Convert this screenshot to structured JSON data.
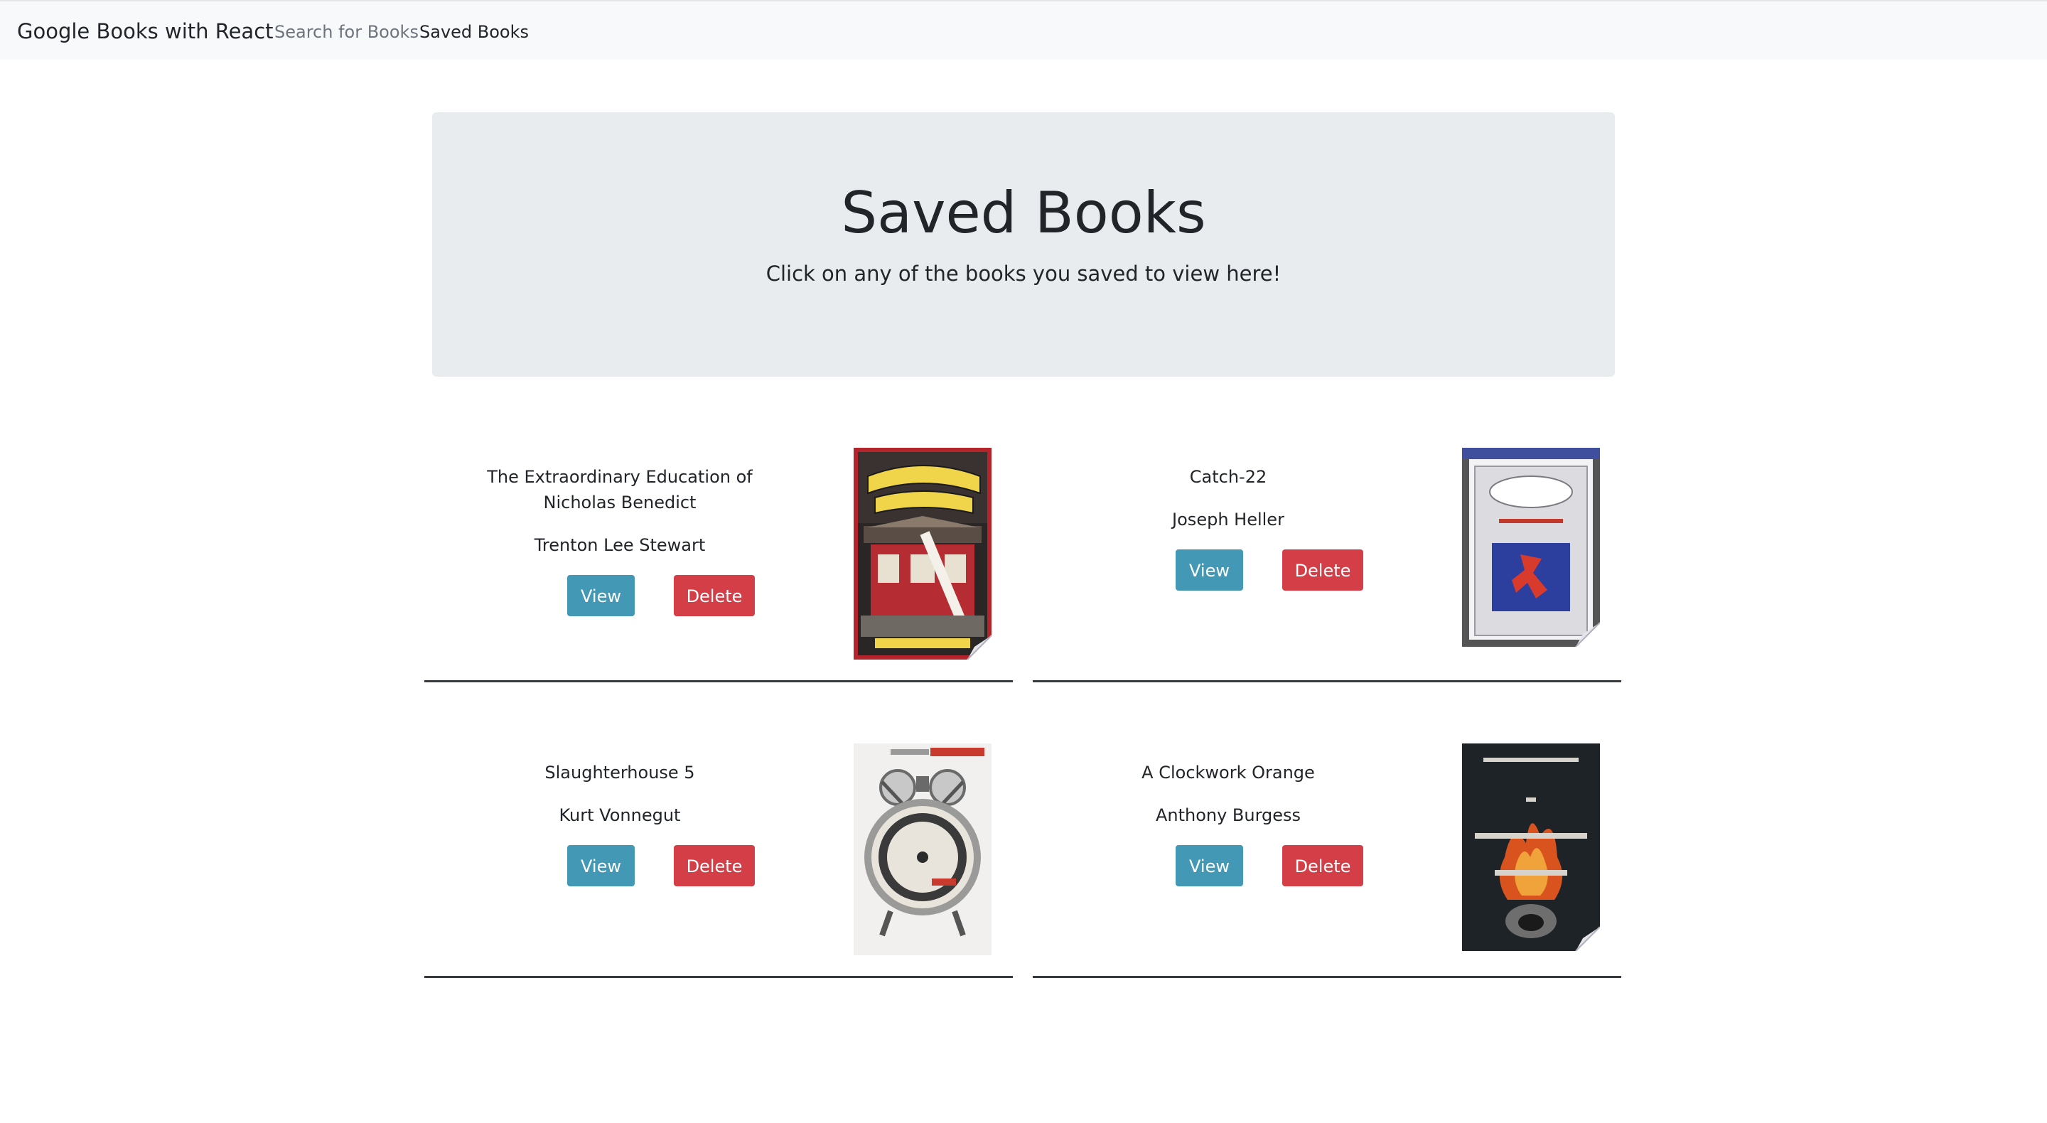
{
  "navbar": {
    "brand": "Google Books with React",
    "links": [
      "Search for Books",
      "Saved Books"
    ]
  },
  "jumbotron": {
    "title": "Saved Books",
    "subtitle": "Click on any of the books you saved to view here!"
  },
  "buttons": {
    "view": "View",
    "delete": "Delete"
  },
  "books": [
    {
      "title": "The Extraordinary Education of Nicholas Benedict",
      "author": "Trenton Lee Stewart"
    },
    {
      "title": "Catch-22",
      "author": "Joseph Heller"
    },
    {
      "title": "Slaughterhouse 5",
      "author": "Kurt Vonnegut"
    },
    {
      "title": "A Clockwork Orange",
      "author": "Anthony Burgess"
    }
  ],
  "colors": {
    "view_button": "#4298b5",
    "delete_button": "#d43f47",
    "jumbotron": "#e9ecef",
    "navbar": "#f8f9fa"
  }
}
